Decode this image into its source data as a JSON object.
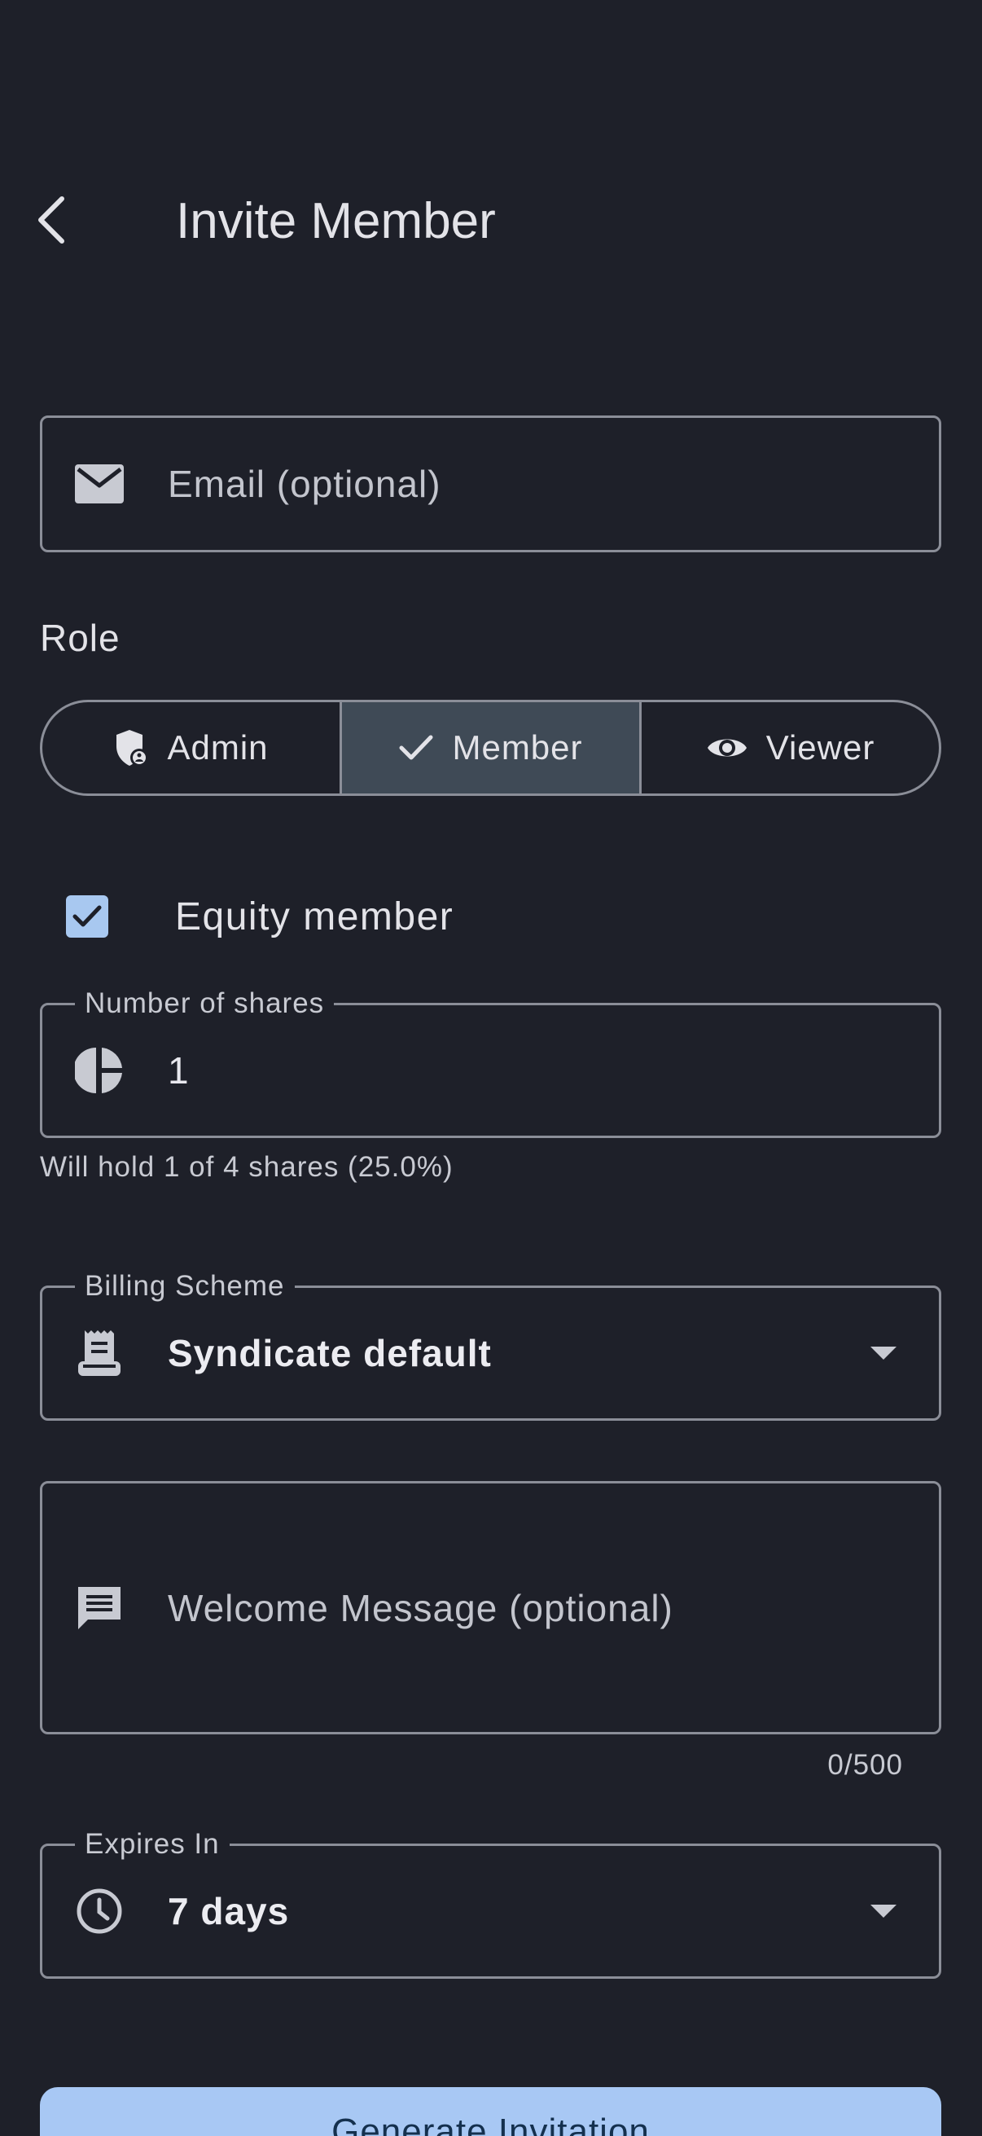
{
  "header": {
    "title": "Invite Member"
  },
  "email": {
    "placeholder": "Email (optional)"
  },
  "role": {
    "label": "Role",
    "options": [
      {
        "label": "Admin",
        "icon": "admin-shield-icon",
        "selected": false
      },
      {
        "label": "Member",
        "icon": "check-icon",
        "selected": true
      },
      {
        "label": "Viewer",
        "icon": "eye-icon",
        "selected": false
      }
    ]
  },
  "equity": {
    "label": "Equity member",
    "checked": true
  },
  "shares": {
    "label": "Number of shares",
    "value": "1",
    "helper": "Will hold 1 of 4 shares (25.0%)"
  },
  "billing": {
    "label": "Billing Scheme",
    "value": "Syndicate default"
  },
  "welcome": {
    "placeholder": "Welcome Message (optional)",
    "counter": "0/500"
  },
  "expires": {
    "label": "Expires In",
    "value": "7 days"
  },
  "actions": {
    "generate_label": "Generate Invitation"
  },
  "colors": {
    "background": "#1e2029",
    "outline": "#8b8e98",
    "selected_segment": "#3f4a56",
    "primary": "#a8c8f4",
    "on_primary": "#14304e"
  }
}
